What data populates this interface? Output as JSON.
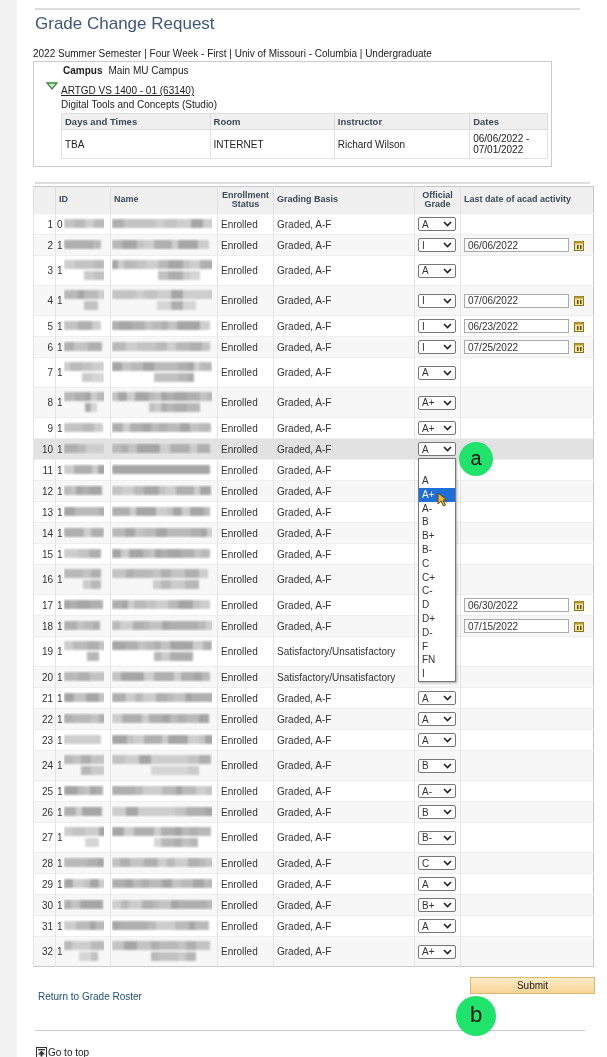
{
  "page": {
    "title": "Grade Change Request",
    "subtitle": "2022 Summer Semester | Four Week - First | Univ of Missouri - Columbia | Undergraduate"
  },
  "section": {
    "expanded": true,
    "campus_label": "Campus",
    "campus": "Main MU Campus",
    "class_link": "ARTGD  VS 1400 - 01 (63140)",
    "description": "Digital Tools and Concepts (Studio)",
    "meeting": {
      "columns": [
        "Days and Times",
        "Room",
        "Instructor",
        "Dates"
      ],
      "rows": [
        [
          "TBA",
          "INTERNET",
          "Richard Wilson",
          "06/06/2022 - 07/01/2022"
        ]
      ]
    }
  },
  "roster": {
    "columns": [
      "ID",
      "Name",
      "Enrollment Status",
      "Grading Basis",
      "Official Grade",
      "Last date of acad activity"
    ],
    "rows": [
      {
        "number": "1",
        "id": "0",
        "wrapped": false,
        "selected": false,
        "status": "Enrolled",
        "basis": "Graded, A-F",
        "grade": "A"
      },
      {
        "number": "2",
        "id": "1",
        "wrapped": false,
        "selected": false,
        "status": "Enrolled",
        "basis": "Graded, A-F",
        "grade": "I",
        "last_date": "06/06/2022"
      },
      {
        "number": "3",
        "id": "1",
        "wrapped": true,
        "selected": false,
        "status": "Enrolled",
        "basis": "Graded, A-F",
        "grade": "A"
      },
      {
        "number": "4",
        "id": "1",
        "wrapped": true,
        "selected": false,
        "status": "Enrolled",
        "basis": "Graded, A-F",
        "grade": "I",
        "last_date": "07/06/2022"
      },
      {
        "number": "5",
        "id": "1",
        "wrapped": false,
        "selected": false,
        "status": "Enrolled",
        "basis": "Graded, A-F",
        "grade": "I",
        "last_date": "06/23/2022"
      },
      {
        "number": "6",
        "id": "1",
        "wrapped": false,
        "selected": false,
        "status": "Enrolled",
        "basis": "Graded, A-F",
        "grade": "I",
        "last_date": "07/25/2022"
      },
      {
        "number": "7",
        "id": "1",
        "wrapped": true,
        "selected": false,
        "status": "Enrolled",
        "basis": "Graded, A-F",
        "grade": "A"
      },
      {
        "number": "8",
        "id": "1",
        "wrapped": true,
        "selected": false,
        "status": "Enrolled",
        "basis": "Graded, A-F",
        "grade": "A+"
      },
      {
        "number": "9",
        "id": "1",
        "wrapped": false,
        "selected": false,
        "status": "Enrolled",
        "basis": "Graded, A-F",
        "grade": "A+"
      },
      {
        "number": "10",
        "id": "1",
        "wrapped": false,
        "selected": true,
        "status": "Enrolled",
        "basis": "Graded, A-F",
        "grade": "A",
        "dropdown": [
          {
            "label": "A",
            "selected": false
          },
          {
            "label": "A+",
            "selected": true
          },
          {
            "label": "A-",
            "selected": false
          },
          {
            "label": "B",
            "selected": false
          },
          {
            "label": "B+",
            "selected": false
          },
          {
            "label": "B-",
            "selected": false
          },
          {
            "label": "C",
            "selected": false
          },
          {
            "label": "C+",
            "selected": false
          },
          {
            "label": "C-",
            "selected": false
          },
          {
            "label": "D",
            "selected": false
          },
          {
            "label": "D+",
            "selected": false
          },
          {
            "label": "D-",
            "selected": false
          },
          {
            "label": "F",
            "selected": false
          },
          {
            "label": "FN",
            "selected": false
          },
          {
            "label": "I",
            "selected": false
          }
        ]
      },
      {
        "number": "11",
        "id": "1",
        "wrapped": false,
        "selected": false,
        "status": "Enrolled",
        "basis": "Graded, A-F"
      },
      {
        "number": "12",
        "id": "1",
        "wrapped": false,
        "selected": false,
        "status": "Enrolled",
        "basis": "Graded, A-F"
      },
      {
        "number": "13",
        "id": "1",
        "wrapped": false,
        "selected": false,
        "status": "Enrolled",
        "basis": "Graded, A-F"
      },
      {
        "number": "14",
        "id": "1",
        "wrapped": false,
        "selected": false,
        "status": "Enrolled",
        "basis": "Graded, A-F"
      },
      {
        "number": "15",
        "id": "1",
        "wrapped": false,
        "selected": false,
        "status": "Enrolled",
        "basis": "Graded, A-F"
      },
      {
        "number": "16",
        "id": "1",
        "wrapped": true,
        "selected": false,
        "status": "Enrolled",
        "basis": "Graded, A-F"
      },
      {
        "number": "17",
        "id": "1",
        "wrapped": false,
        "selected": false,
        "status": "Enrolled",
        "basis": "Graded, A-F",
        "last_date": "06/30/2022"
      },
      {
        "number": "18",
        "id": "1",
        "wrapped": false,
        "selected": false,
        "status": "Enrolled",
        "basis": "Graded, A-F",
        "last_date": "07/15/2022"
      },
      {
        "number": "19",
        "id": "1",
        "wrapped": true,
        "selected": false,
        "status": "Enrolled",
        "basis": "Satisfactory/Unsatisfactory"
      },
      {
        "number": "20",
        "id": "1",
        "wrapped": false,
        "selected": false,
        "status": "Enrolled",
        "basis": "Satisfactory/Unsatisfactory"
      },
      {
        "number": "21",
        "id": "1",
        "wrapped": false,
        "selected": false,
        "status": "Enrolled",
        "basis": "Graded, A-F",
        "grade": "A"
      },
      {
        "number": "22",
        "id": "1",
        "wrapped": false,
        "selected": false,
        "status": "Enrolled",
        "basis": "Graded, A-F",
        "grade": "A"
      },
      {
        "number": "23",
        "id": "1",
        "wrapped": false,
        "selected": false,
        "status": "Enrolled",
        "basis": "Graded, A-F",
        "grade": "A"
      },
      {
        "number": "24",
        "id": "1",
        "wrapped": true,
        "selected": false,
        "status": "Enrolled",
        "basis": "Graded, A-F",
        "grade": "B"
      },
      {
        "number": "25",
        "id": "1",
        "wrapped": false,
        "selected": false,
        "status": "Enrolled",
        "basis": "Graded, A-F",
        "grade": "A-"
      },
      {
        "number": "26",
        "id": "1",
        "wrapped": false,
        "selected": false,
        "status": "Enrolled",
        "basis": "Graded, A-F",
        "grade": "B"
      },
      {
        "number": "27",
        "id": "1",
        "wrapped": true,
        "selected": false,
        "status": "Enrolled",
        "basis": "Graded, A-F",
        "grade": "B-"
      },
      {
        "number": "28",
        "id": "1",
        "wrapped": false,
        "selected": false,
        "status": "Enrolled",
        "basis": "Graded, A-F",
        "grade": "C"
      },
      {
        "number": "29",
        "id": "1",
        "wrapped": false,
        "selected": false,
        "status": "Enrolled",
        "basis": "Graded, A-F",
        "grade": "A"
      },
      {
        "number": "30",
        "id": "1",
        "wrapped": false,
        "selected": false,
        "status": "Enrolled",
        "basis": "Graded, A-F",
        "grade": "B+"
      },
      {
        "number": "31",
        "id": "1",
        "wrapped": false,
        "selected": false,
        "status": "Enrolled",
        "basis": "Graded, A-F",
        "grade": "A"
      },
      {
        "number": "32",
        "id": "1",
        "wrapped": true,
        "selected": false,
        "status": "Enrolled",
        "basis": "Graded, A-F",
        "grade": "A+"
      }
    ]
  },
  "footer": {
    "return_link": "Return to Grade Roster",
    "submit": "Submit",
    "go_to_top": "Go to top"
  },
  "annotations": [
    {
      "kind": "dropdown",
      "label": "a"
    },
    {
      "kind": "submit",
      "label": "b"
    }
  ]
}
